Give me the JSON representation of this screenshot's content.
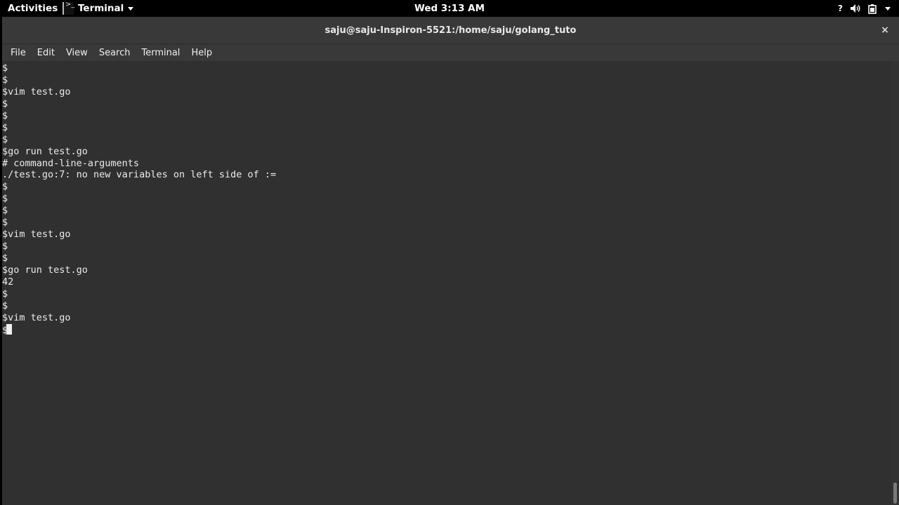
{
  "topbar": {
    "activities": "Activities",
    "app_name": "Terminal",
    "clock": "Wed  3:13 AM",
    "help_icon": "help-icon",
    "volume_icon": "volume-icon",
    "battery_icon": "battery-icon"
  },
  "window": {
    "title": "saju@saju-Inspiron-5521:/home/saju/golang_tuto",
    "close_label": "×"
  },
  "menu": [
    "File",
    "Edit",
    "View",
    "Search",
    "Terminal",
    "Help"
  ],
  "terminal_lines": [
    "$",
    "$",
    "$vim test.go",
    "$",
    "$",
    "$",
    "$",
    "$go run test.go",
    "# command-line-arguments",
    "./test.go:7: no new variables on left side of :=",
    "$",
    "$",
    "$",
    "$",
    "$vim test.go",
    "$",
    "$",
    "$go run test.go",
    "42",
    "$",
    "$",
    "$vim test.go",
    "$"
  ],
  "colors": {
    "terminal_bg": "#303030",
    "terminal_fg": "#ebebeb",
    "topbar_bg": "#000000",
    "titlebar_bg": "#393939"
  }
}
